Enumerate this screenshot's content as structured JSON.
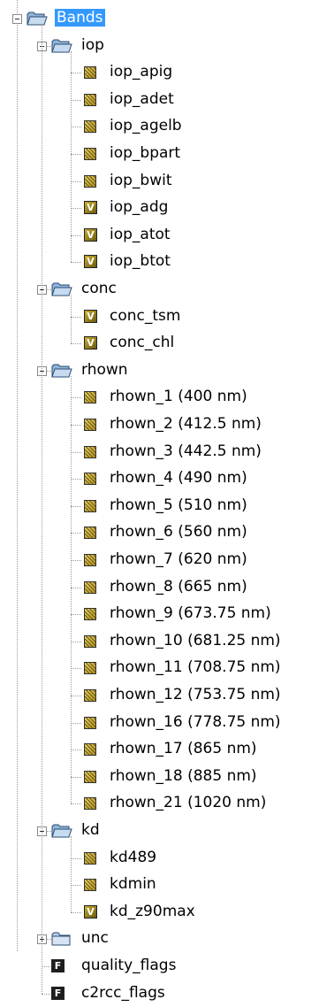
{
  "tree": {
    "root_label": "Bands",
    "groups": [
      {
        "label": "iop",
        "expanded": true,
        "items": [
          {
            "label": "iop_apig",
            "kind": "raster"
          },
          {
            "label": "iop_adet",
            "kind": "raster"
          },
          {
            "label": "iop_agelb",
            "kind": "raster"
          },
          {
            "label": "iop_bpart",
            "kind": "raster"
          },
          {
            "label": "iop_bwit",
            "kind": "raster"
          },
          {
            "label": "iop_adg",
            "kind": "virtual"
          },
          {
            "label": "iop_atot",
            "kind": "virtual"
          },
          {
            "label": "iop_btot",
            "kind": "virtual"
          }
        ]
      },
      {
        "label": "conc",
        "expanded": true,
        "items": [
          {
            "label": "conc_tsm",
            "kind": "virtual"
          },
          {
            "label": "conc_chl",
            "kind": "virtual"
          }
        ]
      },
      {
        "label": "rhown",
        "expanded": true,
        "items": [
          {
            "label": "rhown_1 (400 nm)",
            "kind": "raster"
          },
          {
            "label": "rhown_2 (412.5 nm)",
            "kind": "raster"
          },
          {
            "label": "rhown_3 (442.5 nm)",
            "kind": "raster"
          },
          {
            "label": "rhown_4 (490 nm)",
            "kind": "raster"
          },
          {
            "label": "rhown_5 (510 nm)",
            "kind": "raster"
          },
          {
            "label": "rhown_6 (560 nm)",
            "kind": "raster"
          },
          {
            "label": "rhown_7 (620 nm)",
            "kind": "raster"
          },
          {
            "label": "rhown_8 (665 nm)",
            "kind": "raster"
          },
          {
            "label": "rhown_9 (673.75 nm)",
            "kind": "raster"
          },
          {
            "label": "rhown_10 (681.25 nm)",
            "kind": "raster"
          },
          {
            "label": "rhown_11 (708.75 nm)",
            "kind": "raster"
          },
          {
            "label": "rhown_12 (753.75 nm)",
            "kind": "raster"
          },
          {
            "label": "rhown_16 (778.75 nm)",
            "kind": "raster"
          },
          {
            "label": "rhown_17 (865 nm)",
            "kind": "raster"
          },
          {
            "label": "rhown_18 (885 nm)",
            "kind": "raster"
          },
          {
            "label": "rhown_21 (1020 nm)",
            "kind": "raster"
          }
        ]
      },
      {
        "label": "kd",
        "expanded": true,
        "items": [
          {
            "label": "kd489",
            "kind": "raster"
          },
          {
            "label": "kdmin",
            "kind": "raster"
          },
          {
            "label": "kd_z90max",
            "kind": "virtual"
          }
        ]
      },
      {
        "label": "unc",
        "expanded": false,
        "items": []
      }
    ],
    "root_items": [
      {
        "label": "quality_flags",
        "kind": "flag"
      },
      {
        "label": "c2rcc_flags",
        "kind": "flag"
      }
    ],
    "icon_names": {
      "folder_open": "folder-open-icon",
      "folder_closed": "folder-closed-icon",
      "raster": "raster-band-icon",
      "virtual": "virtual-band-icon",
      "flag": "flag-band-icon"
    },
    "badge_text": {
      "virtual": "V",
      "flag": "F"
    },
    "colors": {
      "selection": "#3399ff",
      "folder": "#8fb3d9",
      "raster_band": "#d1b33a",
      "flag_band": "#1d1d1d"
    }
  }
}
